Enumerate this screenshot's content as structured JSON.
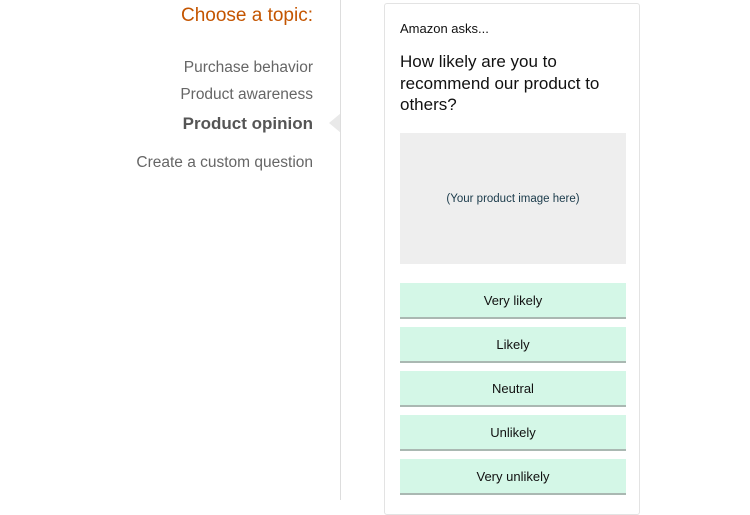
{
  "sidebar": {
    "heading": "Choose a topic:",
    "topics": [
      {
        "label": "Purchase behavior",
        "active": false
      },
      {
        "label": "Product awareness",
        "active": false
      },
      {
        "label": "Product opinion",
        "active": true
      },
      {
        "label": "Create a custom question",
        "active": false
      }
    ]
  },
  "preview": {
    "asker": "Amazon asks...",
    "question": "How likely are you to recommend our product to others?",
    "image_placeholder": "(Your product image here)",
    "answers": [
      "Very likely",
      "Likely",
      "Neutral",
      "Unlikely",
      "Very unlikely"
    ]
  },
  "colors": {
    "heading": "#c45500",
    "answer_background": "#d4f7e7",
    "image_placeholder_background": "#eeeeee"
  }
}
